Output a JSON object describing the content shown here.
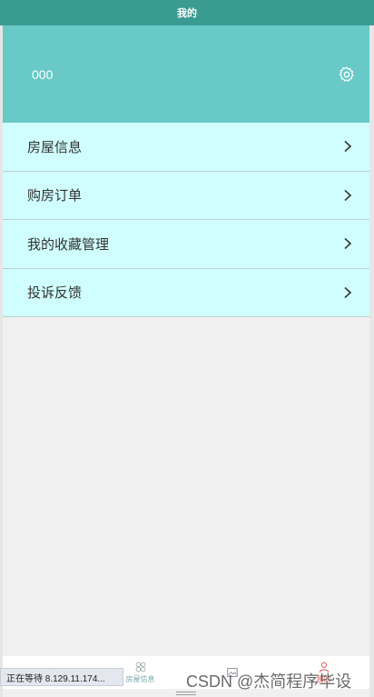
{
  "topbar": {
    "title": "我的"
  },
  "header": {
    "username": "000",
    "settings_icon": "gear-icon"
  },
  "menu": {
    "items": [
      {
        "label": "房屋信息",
        "icon": "chevron-right-icon"
      },
      {
        "label": "购房订单",
        "icon": "chevron-right-icon"
      },
      {
        "label": "我的收藏管理",
        "icon": "chevron-right-icon"
      },
      {
        "label": "投诉反馈",
        "icon": "chevron-right-icon"
      }
    ]
  },
  "tabbar": {
    "tabs": [
      {
        "label": "",
        "icon": "home-icon"
      },
      {
        "label": "房屋信息",
        "icon": "grid-icon"
      },
      {
        "label": "",
        "icon": "image-icon"
      },
      {
        "label": "我的",
        "icon": "user-icon",
        "active": true
      }
    ]
  },
  "status": {
    "text": "正在等待 8.129.11.174..."
  },
  "watermark": {
    "text": "CSDN @杰简程序毕设"
  },
  "colors": {
    "topbar": "#3a9b92",
    "header": "#69c9c6",
    "menu_item": "#d0fdfd",
    "active_tab": "#e06060"
  }
}
